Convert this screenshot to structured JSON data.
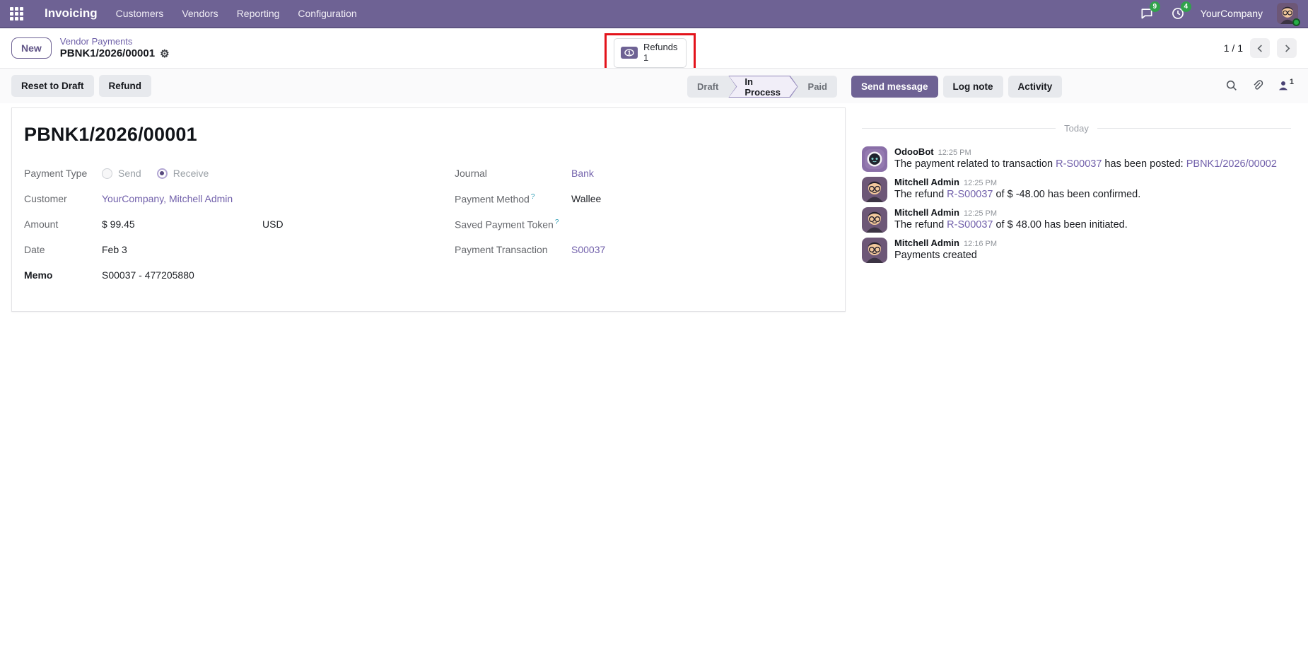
{
  "colors": {
    "brand": "#6e6294",
    "link": "#7261ab",
    "badge_green": "#31a24c",
    "annotation_red": "#e3131b",
    "help_teal": "#2e9db5"
  },
  "topnav": {
    "app_name": "Invoicing",
    "menus": [
      "Customers",
      "Vendors",
      "Reporting",
      "Configuration"
    ],
    "message_badge": "9",
    "activity_badge": "4",
    "company": "YourCompany"
  },
  "breadcrumb": {
    "new_label": "New",
    "parent": "Vendor Payments",
    "current": "PBNK1/2026/00001"
  },
  "stat_button": {
    "label": "Refunds",
    "count": "1"
  },
  "pager": {
    "value": "1 / 1"
  },
  "actions": {
    "reset": "Reset to Draft",
    "refund": "Refund"
  },
  "statusbar": {
    "steps": [
      {
        "label": "Draft"
      },
      {
        "label": "In Process"
      },
      {
        "label": "Paid"
      }
    ],
    "active": "In Process"
  },
  "form": {
    "title": "PBNK1/2026/00001",
    "payment_type": {
      "label": "Payment Type",
      "options": [
        "Send",
        "Receive"
      ],
      "selected": "Receive"
    },
    "customer": {
      "label": "Customer",
      "value": "YourCompany, Mitchell Admin"
    },
    "amount": {
      "label": "Amount",
      "value": "$ 99.45",
      "currency": "USD"
    },
    "date": {
      "label": "Date",
      "value": "Feb 3"
    },
    "memo": {
      "label": "Memo",
      "value": "S00037 - 477205880"
    },
    "journal": {
      "label": "Journal",
      "value": "Bank"
    },
    "payment_method": {
      "label": "Payment Method",
      "help": "?",
      "value": "Wallee"
    },
    "saved_token": {
      "label": "Saved Payment Token",
      "help": "?",
      "value": ""
    },
    "transaction": {
      "label": "Payment Transaction",
      "value": "S00037"
    }
  },
  "chatter": {
    "buttons": {
      "send": "Send message",
      "log": "Log note",
      "activity": "Activity"
    },
    "followers_count": "1",
    "divider": "Today",
    "messages": [
      {
        "author": "OdooBot",
        "time": "12:25 PM",
        "avatar": "odoobot",
        "parts": [
          {
            "text": "The payment related to transaction "
          },
          {
            "text": "R-S00037",
            "link": true
          },
          {
            "text": " has been posted: "
          },
          {
            "text": "PBNK1/2026/00002",
            "link": true
          }
        ]
      },
      {
        "author": "Mitchell Admin",
        "time": "12:25 PM",
        "avatar": "mitchell",
        "parts": [
          {
            "text": "The refund "
          },
          {
            "text": "R-S00037",
            "link": true
          },
          {
            "text": " of $ -48.00 has been confirmed."
          }
        ]
      },
      {
        "author": "Mitchell Admin",
        "time": "12:25 PM",
        "avatar": "mitchell",
        "parts": [
          {
            "text": "The refund "
          },
          {
            "text": "R-S00037",
            "link": true
          },
          {
            "text": " of $ 48.00 has been initiated."
          }
        ]
      },
      {
        "author": "Mitchell Admin",
        "time": "12:16 PM",
        "avatar": "mitchell",
        "parts": [
          {
            "text": "Payments created"
          }
        ]
      }
    ]
  }
}
